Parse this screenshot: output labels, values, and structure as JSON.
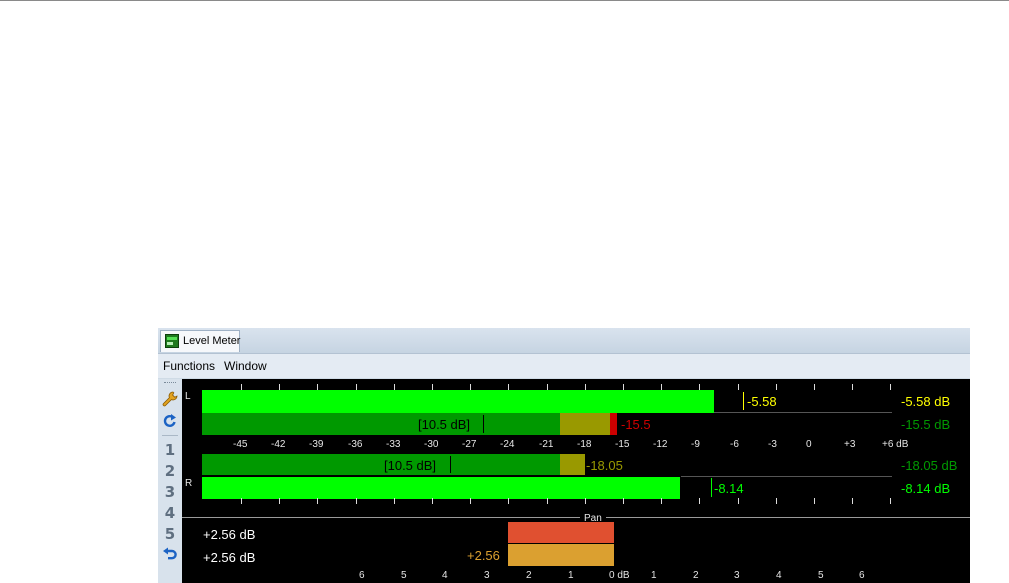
{
  "window": {
    "tab_title": "Level Meter",
    "icon": "level-meter-icon"
  },
  "menu": {
    "functions": "Functions",
    "window": "Window"
  },
  "toolbar": {
    "settings_icon": "wrench-icon",
    "reset_icon": "reset-peaks-icon",
    "preset_1": "1",
    "preset_2": "2",
    "preset_3": "3",
    "preset_4": "4",
    "preset_5": "5",
    "undo_icon": "undo-icon"
  },
  "scale": {
    "labels": [
      "-45",
      "-42",
      "-39",
      "-36",
      "-33",
      "-30",
      "-27",
      "-24",
      "-21",
      "-18",
      "-15",
      "-12",
      "-9",
      "-6",
      "-3",
      "0",
      "+3",
      "+6 dB"
    ],
    "unit": "dB"
  },
  "channels": {
    "L": {
      "label": "L",
      "peak_marker_value": "-5.58",
      "peak_readout": "-5.58 dB",
      "rms_bracket": "[10.5 dB]",
      "rms_value": "-15.5",
      "rms_readout": "-15.5 dB"
    },
    "R": {
      "label": "R",
      "peak_marker_value": "-8.14",
      "peak_readout": "-8.14 dB",
      "rms_bracket": "[10.5 dB]",
      "rms_value": "-18.05",
      "rms_readout": "-18.05 dB"
    }
  },
  "pan": {
    "label": "Pan",
    "peak_balance": "+2.56 dB",
    "rms_balance": "+2.56 dB",
    "rms_bar_value": "+2.56",
    "scale_labels": [
      "6",
      "5",
      "4",
      "3",
      "2",
      "1",
      "0 dB",
      "1",
      "2",
      "3",
      "4",
      "5",
      "6"
    ]
  },
  "colors": {
    "peak_green": "#00ff00",
    "rms_green": "#009900",
    "rms_olive": "#999900",
    "clip_red": "#cc0000",
    "pan_peak": "#e05030",
    "pan_rms": "#dba030"
  }
}
